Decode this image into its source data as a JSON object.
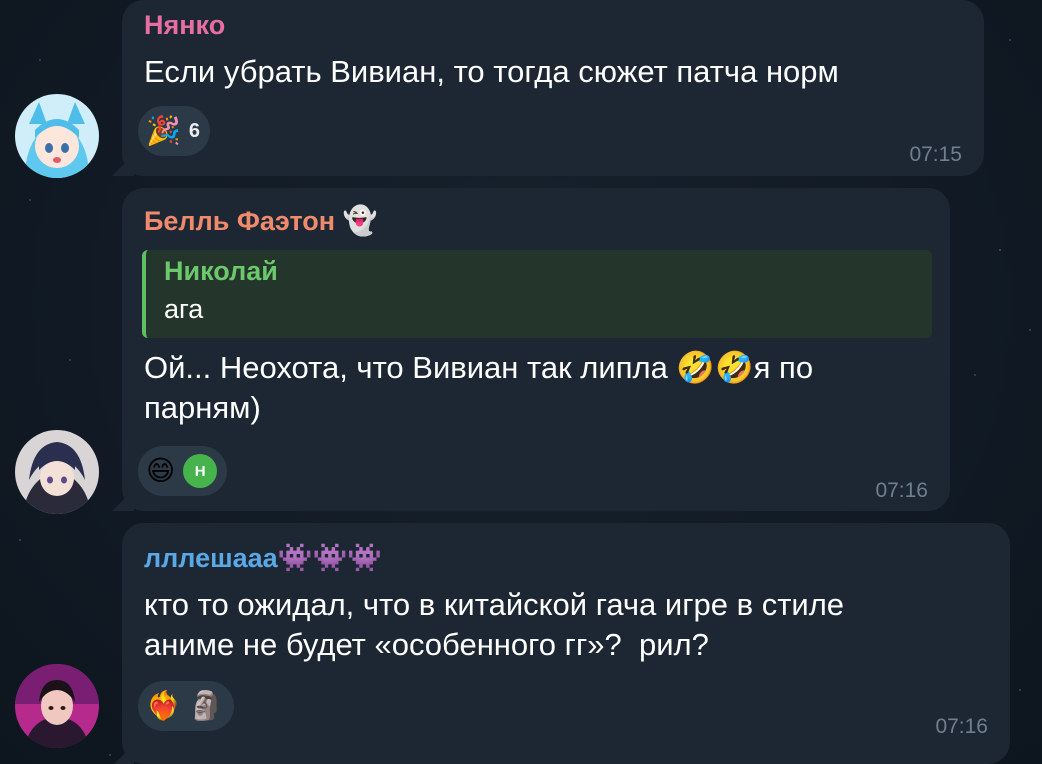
{
  "messages": [
    {
      "sender": "Нянко",
      "sender_color": "#e66ea0",
      "text": "Если убрать Вивиан, то тогда сюжет патча норм",
      "reactions": [
        {
          "emoji": "🎉",
          "count": "6"
        }
      ],
      "time": "07:15"
    },
    {
      "sender": "Белль Фаэтон",
      "sender_emoji": "👻",
      "sender_color": "#f08a6c",
      "reply": {
        "name": "Николай",
        "text": "ага"
      },
      "text_line1": "Ой... Неохота, что Вивиан так липла 🤣🤣я по",
      "text_line2": "парням)",
      "reactions": [
        {
          "emoji": "😄"
        },
        {
          "avatar_letter": "Н",
          "avatar_color": "#47b34d"
        }
      ],
      "time": "07:16"
    },
    {
      "sender": "лллешааа",
      "sender_emoji": "👾👾👾",
      "sender_color": "#5aa9e6",
      "text_line1": "кто то ожидал, что в китайской гача игре в стиле",
      "text_line2": "аниме не будет «особенного гг»?  рил?",
      "reactions": [
        {
          "emoji": "❤️‍🔥"
        },
        {
          "emoji": "🗿"
        }
      ],
      "time": "07:16"
    }
  ]
}
